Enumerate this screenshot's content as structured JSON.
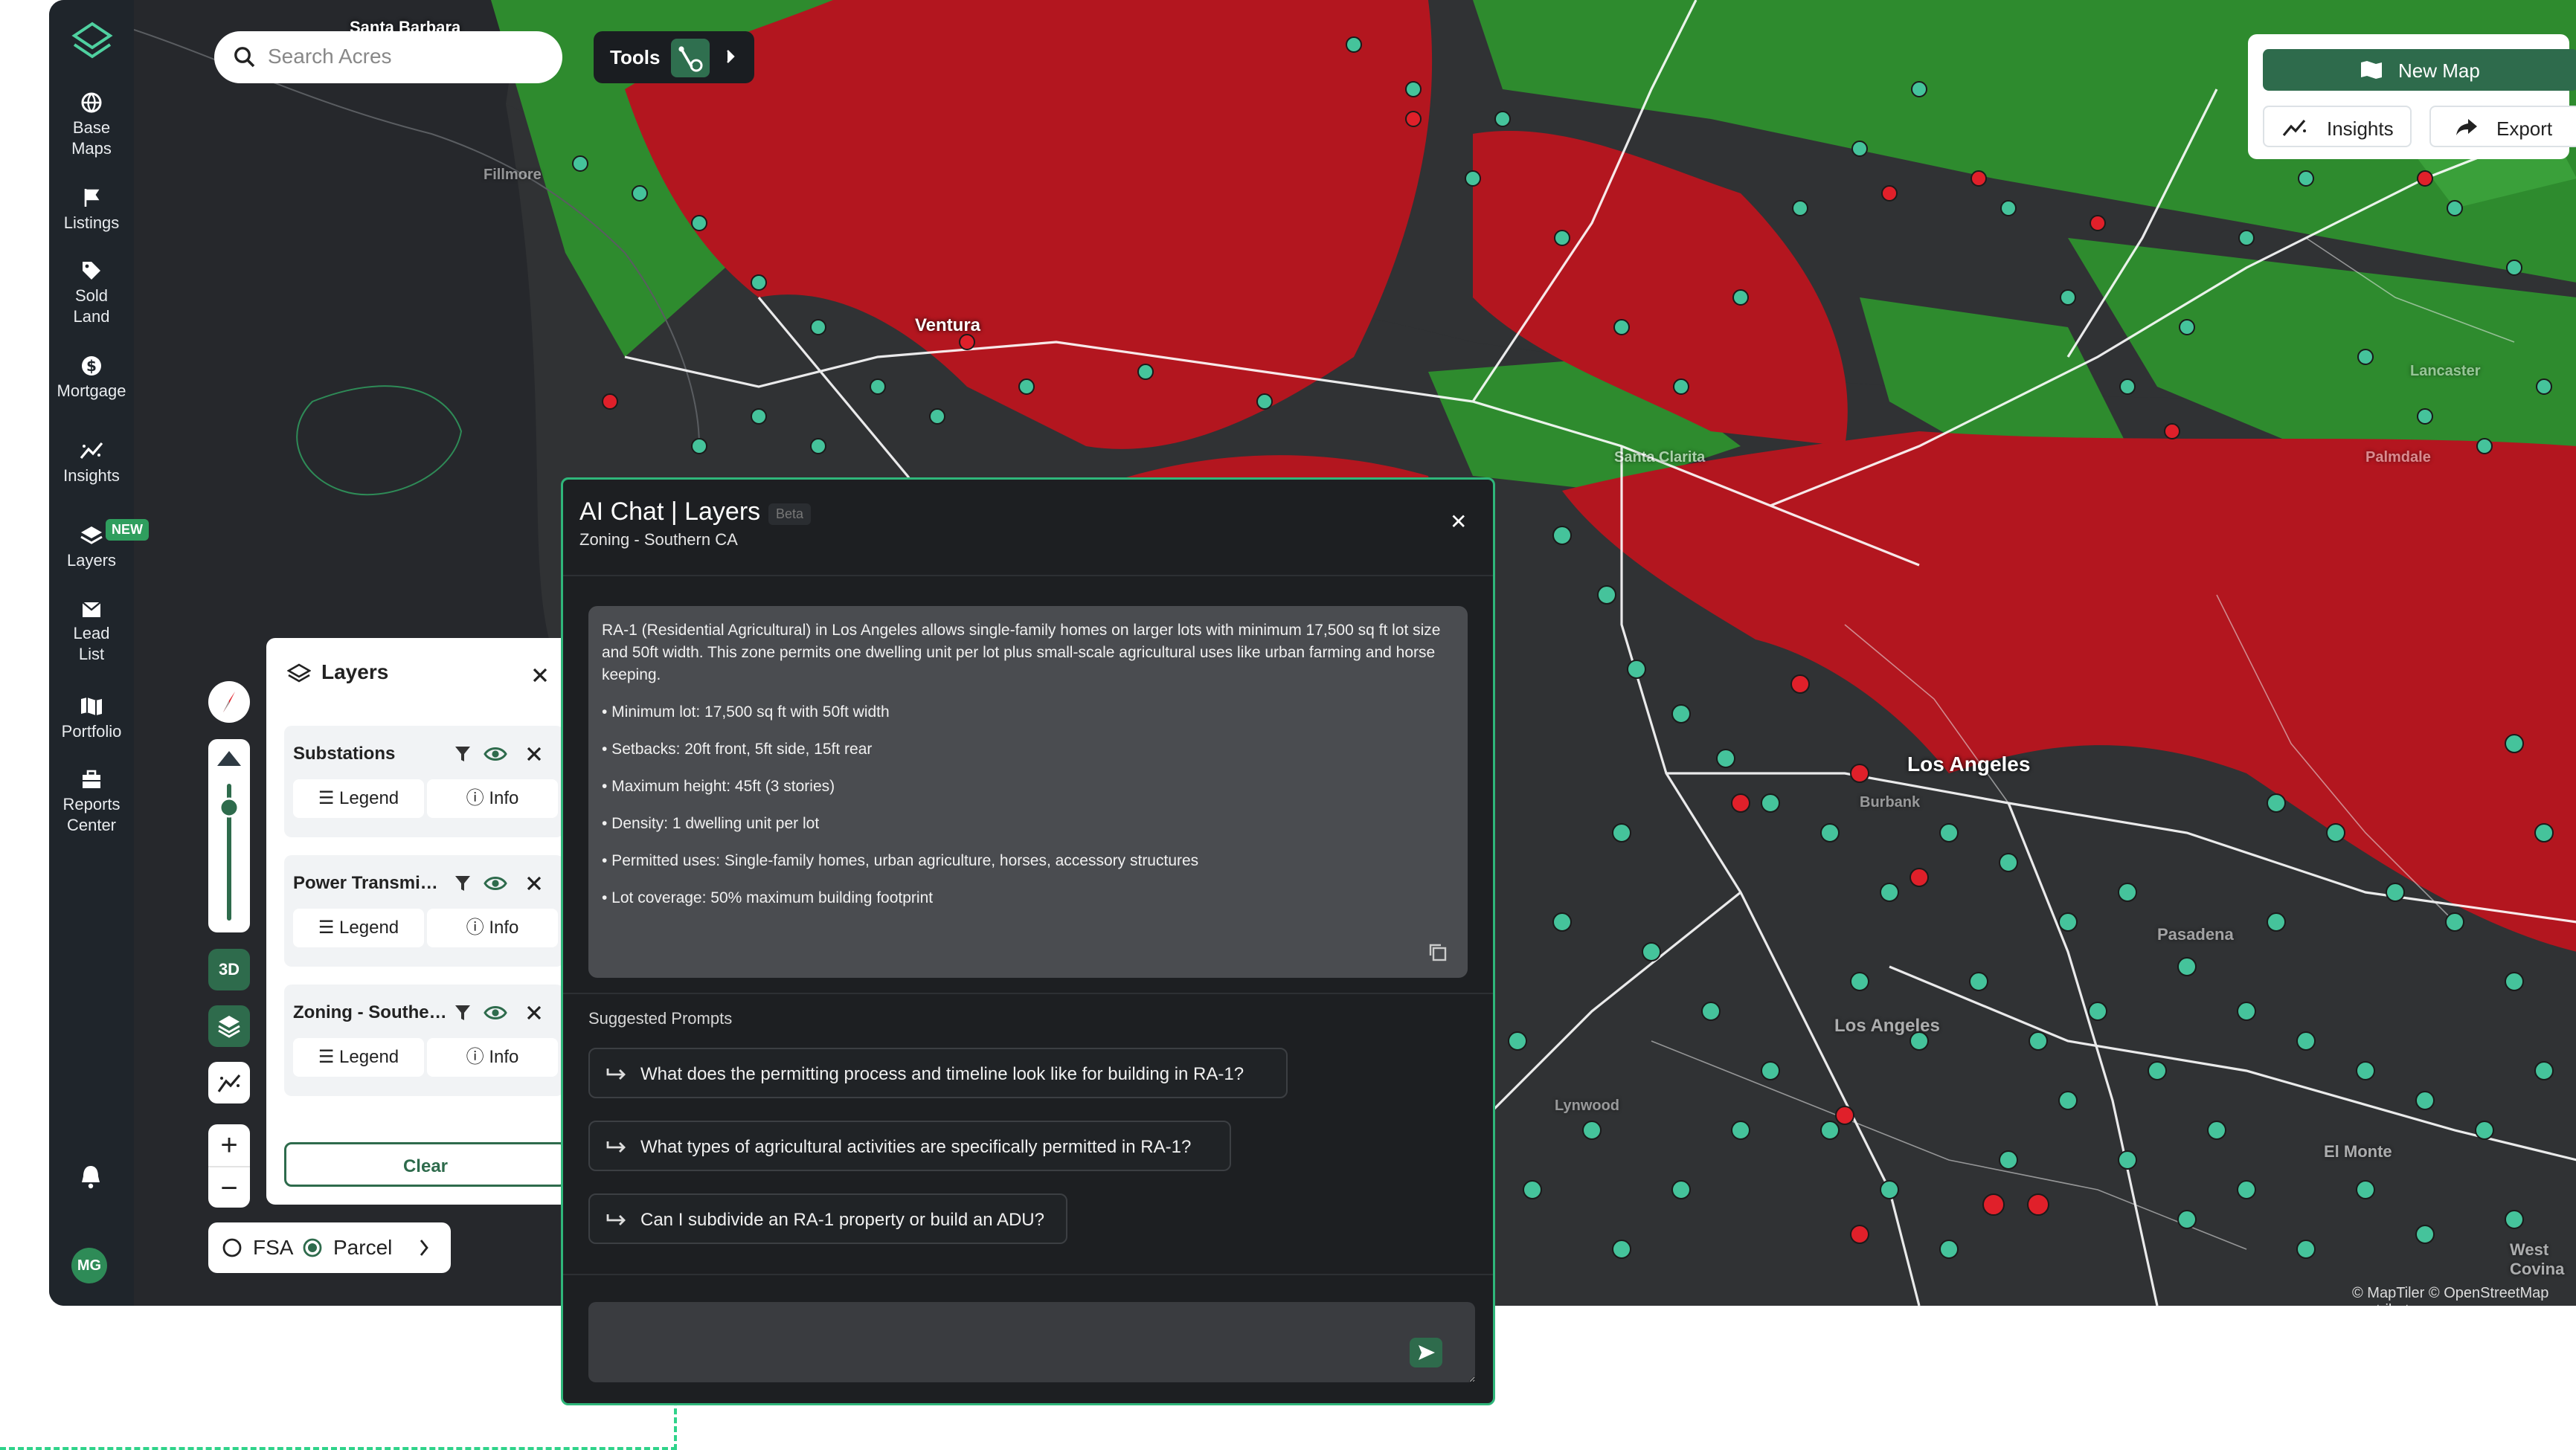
{
  "sidebar": {
    "items": [
      {
        "label": "Base Maps",
        "icon": "globe-icon"
      },
      {
        "label": "Listings",
        "icon": "flag-icon"
      },
      {
        "label": "Sold Land",
        "icon": "tag-icon"
      },
      {
        "label": "Mortgage",
        "icon": "dollar-icon"
      },
      {
        "label": "Insights",
        "icon": "insights-icon"
      },
      {
        "label": "Layers",
        "icon": "layers-icon"
      },
      {
        "label": "Lead List",
        "icon": "mail-icon"
      },
      {
        "label": "Portfolio",
        "icon": "map-icon"
      },
      {
        "label": "Reports Center",
        "icon": "briefcase-icon"
      }
    ],
    "new_badge": "NEW",
    "avatar": "MG"
  },
  "search": {
    "placeholder": "Search Acres"
  },
  "tools": {
    "label": "Tools"
  },
  "topright": {
    "new_map": "New Map",
    "insights": "Insights",
    "export": "Export"
  },
  "map": {
    "labels": [
      "Santa Barbara",
      "Ventura",
      "Los Angeles",
      "Pasadena",
      "Los Angeles",
      "Santa Clarita",
      "El Monte",
      "West Covina",
      "Lancaster",
      "Palmdale",
      "Lynwood",
      "Fillmore",
      "Burbank"
    ],
    "attribution": "© MapTiler © OpenStreetMap contributors",
    "colors": {
      "zoning_red": "#b3161f",
      "zoning_green": "#2e8b2e",
      "substation": "#45c39b",
      "power_line": "#ffffff",
      "ocean": "#26282c"
    }
  },
  "controls": {
    "btn3d": "3D",
    "zoom_in": "+",
    "zoom_out": "−"
  },
  "fsa": {
    "option1": "FSA",
    "option2": "Parcel"
  },
  "layers": {
    "title": "Layers",
    "items": [
      {
        "name": "Substations",
        "legend": "Legend",
        "info": "Info"
      },
      {
        "name": "Power Transmission",
        "legend": "Legend",
        "info": "Info"
      },
      {
        "name": "Zoning - Southern CA",
        "legend": "Legend",
        "info": "Info"
      }
    ],
    "clear": "Clear"
  },
  "chat": {
    "title": "AI Chat | Layers",
    "beta": "Beta",
    "subtitle": "Zoning - Southern CA",
    "message": {
      "intro": "RA-1 (Residential Agricultural) in Los Angeles allows single-family homes on larger lots with minimum 17,500 sq ft lot size and 50ft width. This zone permits one dwelling unit per lot plus small-scale agricultural uses like urban farming and horse keeping.",
      "bullets": [
        "• Minimum lot: 17,500 sq ft with 50ft width",
        "• Setbacks: 20ft front, 5ft side, 15ft rear",
        "• Maximum height: 45ft (3 stories)",
        "• Density: 1 dwelling unit per lot",
        "• Permitted uses: Single-family homes, urban agriculture, horses, accessory structures",
        "• Lot coverage: 50% maximum building footprint"
      ]
    },
    "suggested_label": "Suggested Prompts",
    "prompts": [
      "What does the permitting process and timeline look like for building in RA-1?",
      "What types of agricultural activities are specifically permitted in RA-1?",
      "Can I subdivide an RA-1 property or build an ADU?"
    ]
  }
}
